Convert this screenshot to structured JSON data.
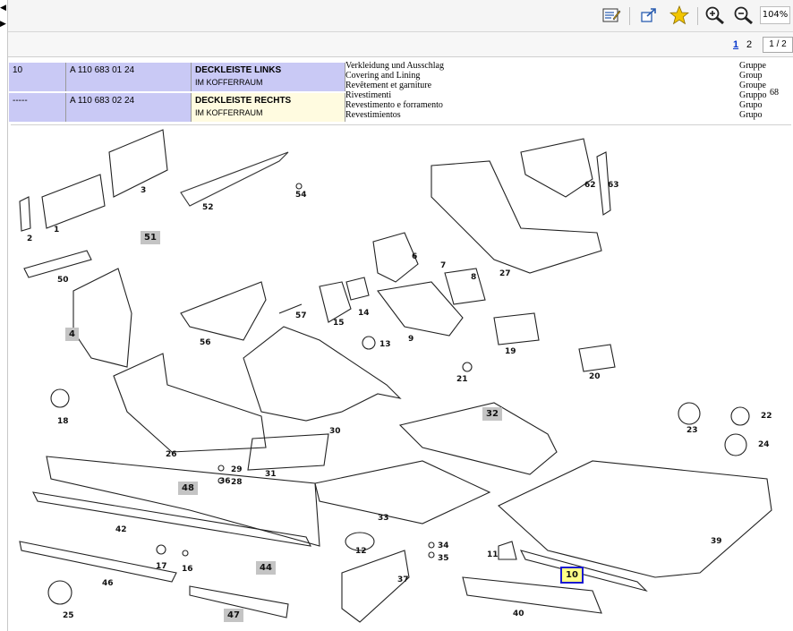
{
  "toolbar": {
    "zoom": "104%",
    "buttons": [
      "edit-icon",
      "expand-icon",
      "star-icon",
      "zoom-in-icon",
      "zoom-out-icon"
    ]
  },
  "pager": {
    "pages": [
      "1",
      "2"
    ],
    "current": "1",
    "box": "1 / 2"
  },
  "parts_table": {
    "rows": [
      {
        "pos": "10",
        "part": "A 110 683 01 24",
        "title": "DECKLEISTE LINKS",
        "subtitle": "IM KOFFERRAUM"
      },
      {
        "pos": "-----",
        "part": "A 110 683 02 24",
        "title": "DECKLEISTE RECHTS",
        "subtitle": "IM KOFFERRAUM"
      }
    ],
    "translations": [
      "Verkleidung und Ausschlag",
      "Covering and Lining",
      "Revêtement et garniture",
      "Rivestimenti",
      "Revestimento e forramento",
      "Revestimientos"
    ],
    "groups": [
      "Gruppe",
      "Group",
      "Groupe",
      "Gruppo",
      "Grupo",
      "Grupo"
    ],
    "page_code": "68"
  },
  "diagram": {
    "callouts": [
      "1",
      "2",
      "3",
      "4",
      "6",
      "7",
      "8",
      "9",
      "10",
      "11",
      "12",
      "13",
      "14",
      "15",
      "16",
      "17",
      "18",
      "19",
      "20",
      "21",
      "22",
      "23",
      "24",
      "25",
      "26",
      "27",
      "28",
      "29",
      "30",
      "31",
      "32",
      "33",
      "34",
      "35",
      "36",
      "37",
      "39",
      "40",
      "42",
      "44",
      "46",
      "47",
      "48",
      "50",
      "51",
      "52",
      "54",
      "56",
      "57",
      "62",
      "63"
    ]
  }
}
